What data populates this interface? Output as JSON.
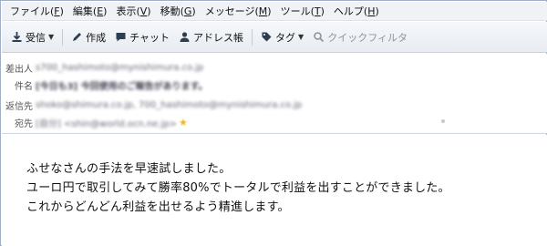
{
  "menubar": {
    "items": [
      {
        "text": "ファイル(",
        "key": "F",
        "end": ")"
      },
      {
        "text": "編集(",
        "key": "E",
        "end": ")"
      },
      {
        "text": "表示(",
        "key": "V",
        "end": ")"
      },
      {
        "text": "移動(",
        "key": "G",
        "end": ")"
      },
      {
        "text": "メッセージ(",
        "key": "M",
        "end": ")"
      },
      {
        "text": "ツール(",
        "key": "T",
        "end": ")"
      },
      {
        "text": "ヘルプ(",
        "key": "H",
        "end": ")"
      }
    ]
  },
  "toolbar": {
    "receive_label": "受信",
    "compose_label": "作成",
    "chat_label": "チャット",
    "addressbook_label": "アドレス帳",
    "tag_label": "タグ",
    "quickfilter_label": "クイックフィルタ"
  },
  "headers": {
    "from_label": "差出人",
    "from_value": "s700_hashimoto@mynishimura.co.jp",
    "subject_label": "件名",
    "subject_value": "[今日も3] 今回使用のご報告があります。",
    "replyto_label": "返信先",
    "replyto_value": "shoko@shimura.co.jp, 700_hashimoto@mynishimura.co.jp",
    "to_label": "宛先",
    "to_value": "[自分] <shin@world.ocn.ne.jp>"
  },
  "body": {
    "lines": [
      "ふせなさんの手法を早速試しました。",
      "ユーロ円で取引してみて勝率80%でトータルで利益を出すことができました。",
      "これからどんどん利益を出せるよう精進します。"
    ]
  },
  "colors": {
    "menubar_bg": "#f0f2f5",
    "toolbar_bg": "#e7ecf2",
    "star": "#f2b51d"
  }
}
